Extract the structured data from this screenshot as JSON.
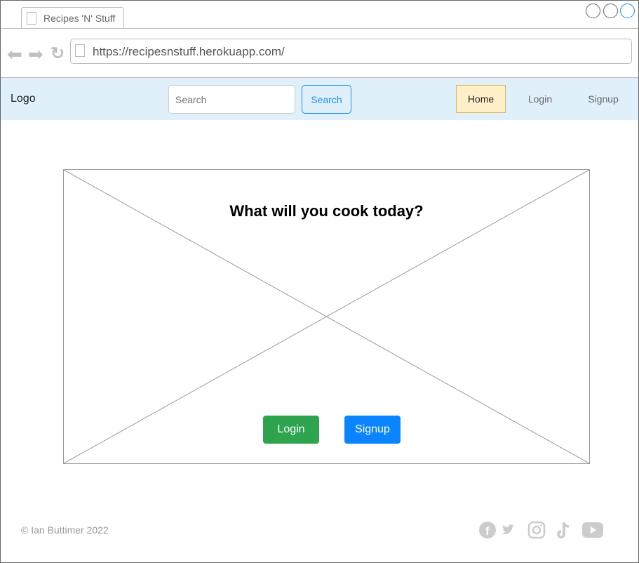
{
  "browser": {
    "tab_title": "Recipes 'N' Stuff",
    "url": "https://recipesnstuff.herokuapp.com/"
  },
  "header": {
    "logo": "Logo",
    "search_placeholder": "Search",
    "search_button": "Search",
    "nav": [
      "Home",
      "Login",
      "Signup"
    ]
  },
  "hero": {
    "title": "What will you cook today?",
    "login": "Login",
    "signup": "Signup"
  },
  "footer": {
    "copyright": "© Ian Buttimer 2022",
    "social": [
      "facebook",
      "twitter",
      "instagram",
      "tiktok",
      "youtube"
    ]
  },
  "colors": {
    "login": "#2ea44f",
    "signup": "#0a84ff",
    "header_bg": "#e0f0fb"
  }
}
